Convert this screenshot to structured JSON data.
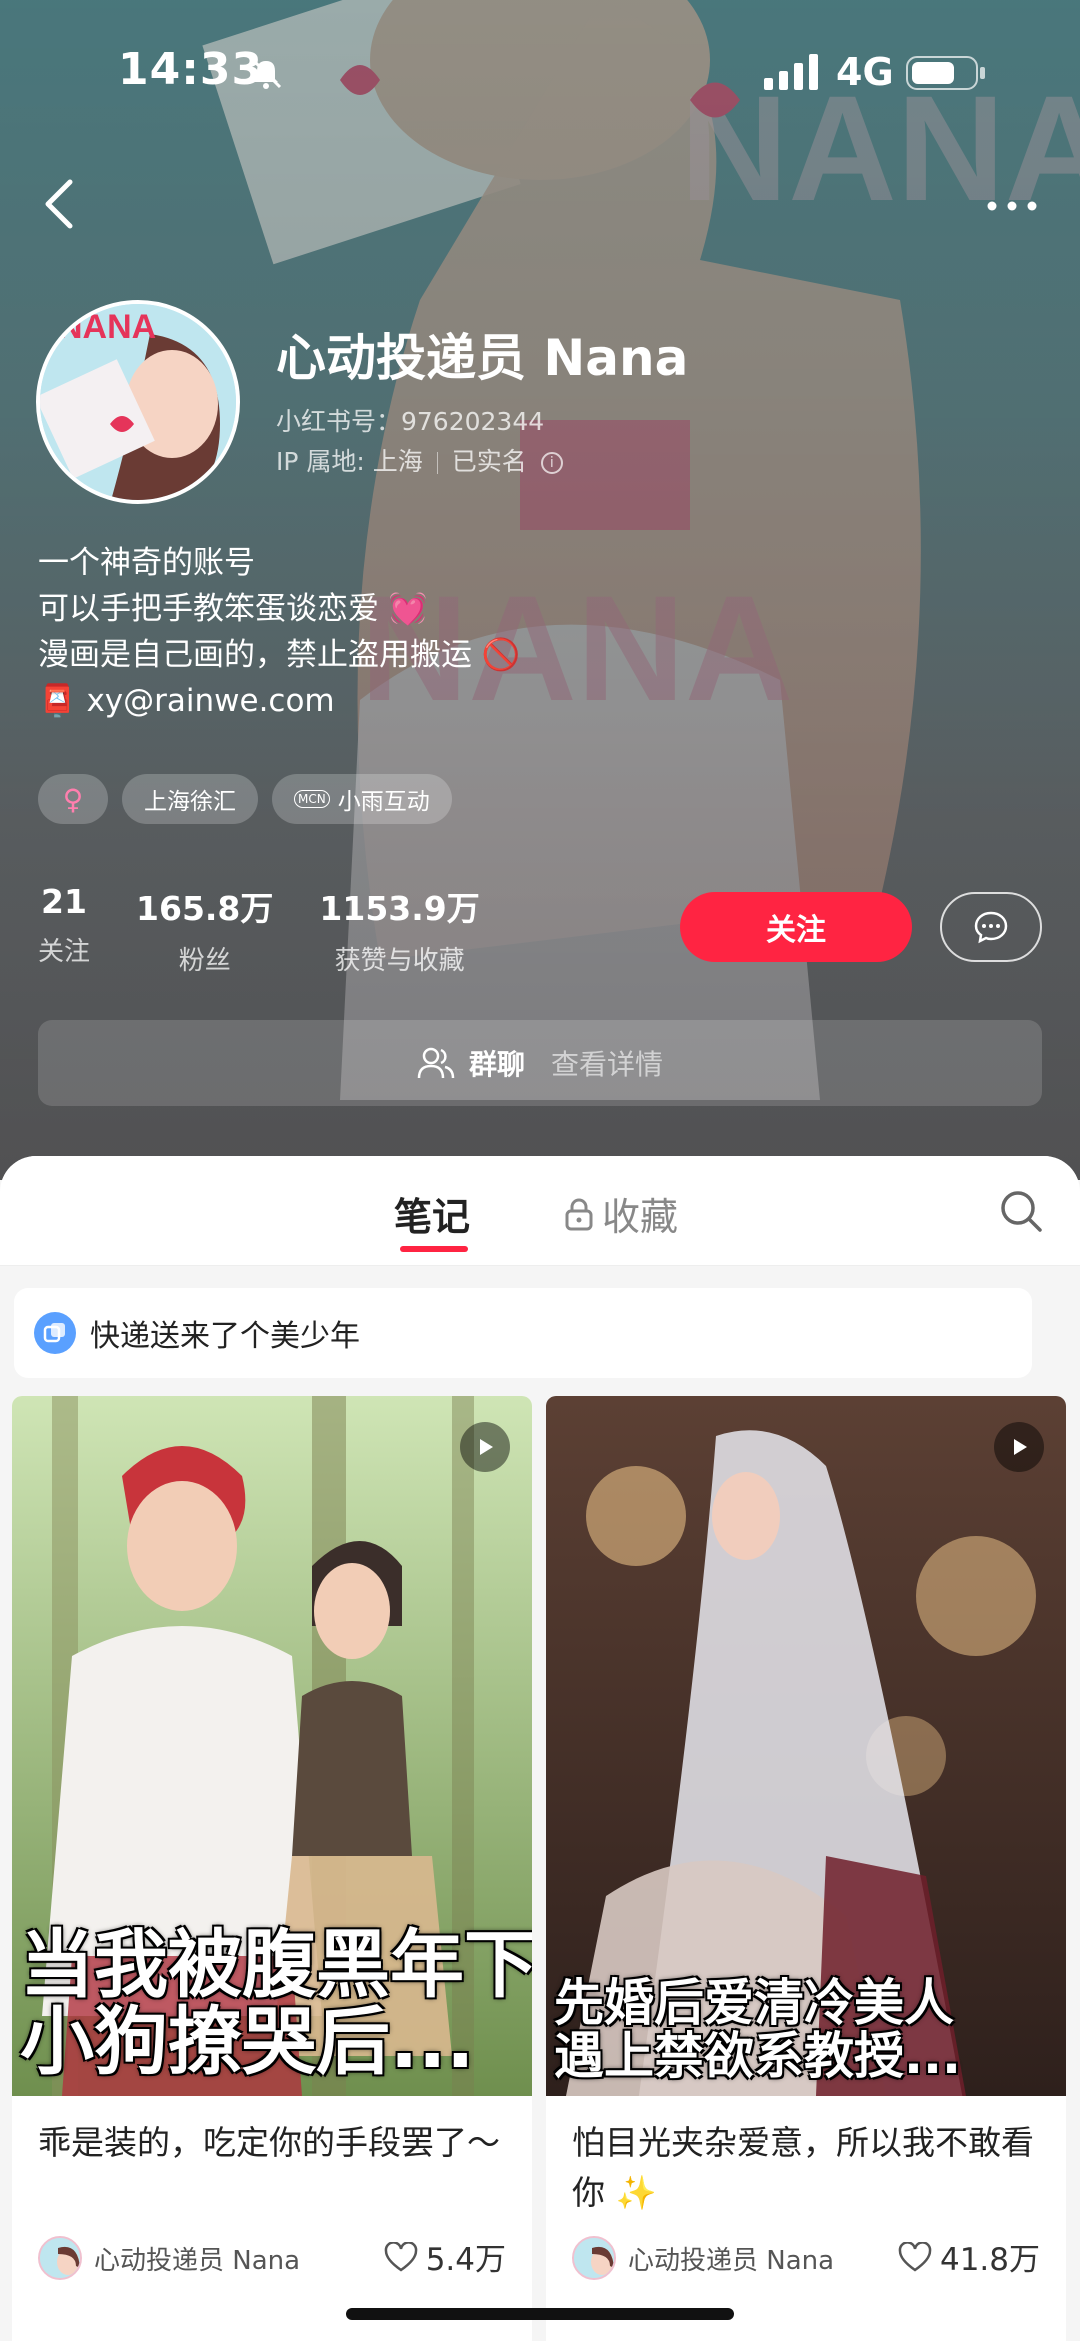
{
  "status_bar": {
    "time": "14:33",
    "network": "4G"
  },
  "profile": {
    "name": "心动投递员 Nana",
    "xhs_id": "小红书号：976202344",
    "ip": "IP 属地: 上海",
    "verified": "已实名",
    "bio": [
      "一个神奇的账号",
      "可以手把手教笨蛋谈恋爱 💓",
      "漫画是自己画的，禁止盗用搬运 🚫",
      "📮 xy@rainwe.com"
    ],
    "tags": {
      "gender": "♀",
      "location": "上海徐汇",
      "mcn": "小雨互动"
    },
    "stats": [
      {
        "value": "21",
        "label": "关注"
      },
      {
        "value": "165.8万",
        "label": "粉丝"
      },
      {
        "value": "1153.9万",
        "label": "获赞与收藏"
      }
    ],
    "follow_label": "关注",
    "group": {
      "label": "群聊",
      "more": "查看详情"
    }
  },
  "tabs": {
    "notes": "笔记",
    "favorites": "收藏"
  },
  "collection": {
    "title": "快递送来了个美少年"
  },
  "cards": [
    {
      "caption": [
        "当我被腹黑年下",
        "小狗撩哭后..."
      ],
      "title": "乖是装的，吃定你的手段罢了～",
      "author": "心动投递员 Nana",
      "likes": "5.4万"
    },
    {
      "caption": [
        "先婚后爱清冷美人",
        "遇上禁欲系教授..."
      ],
      "title": "怕目光夹杂爱意，所以我不敢看你 ✨",
      "author": "心动投递员 Nana",
      "likes": "41.8万"
    }
  ],
  "colors": {
    "accent": "#ff2442",
    "header_bg": "#5a7c80"
  }
}
